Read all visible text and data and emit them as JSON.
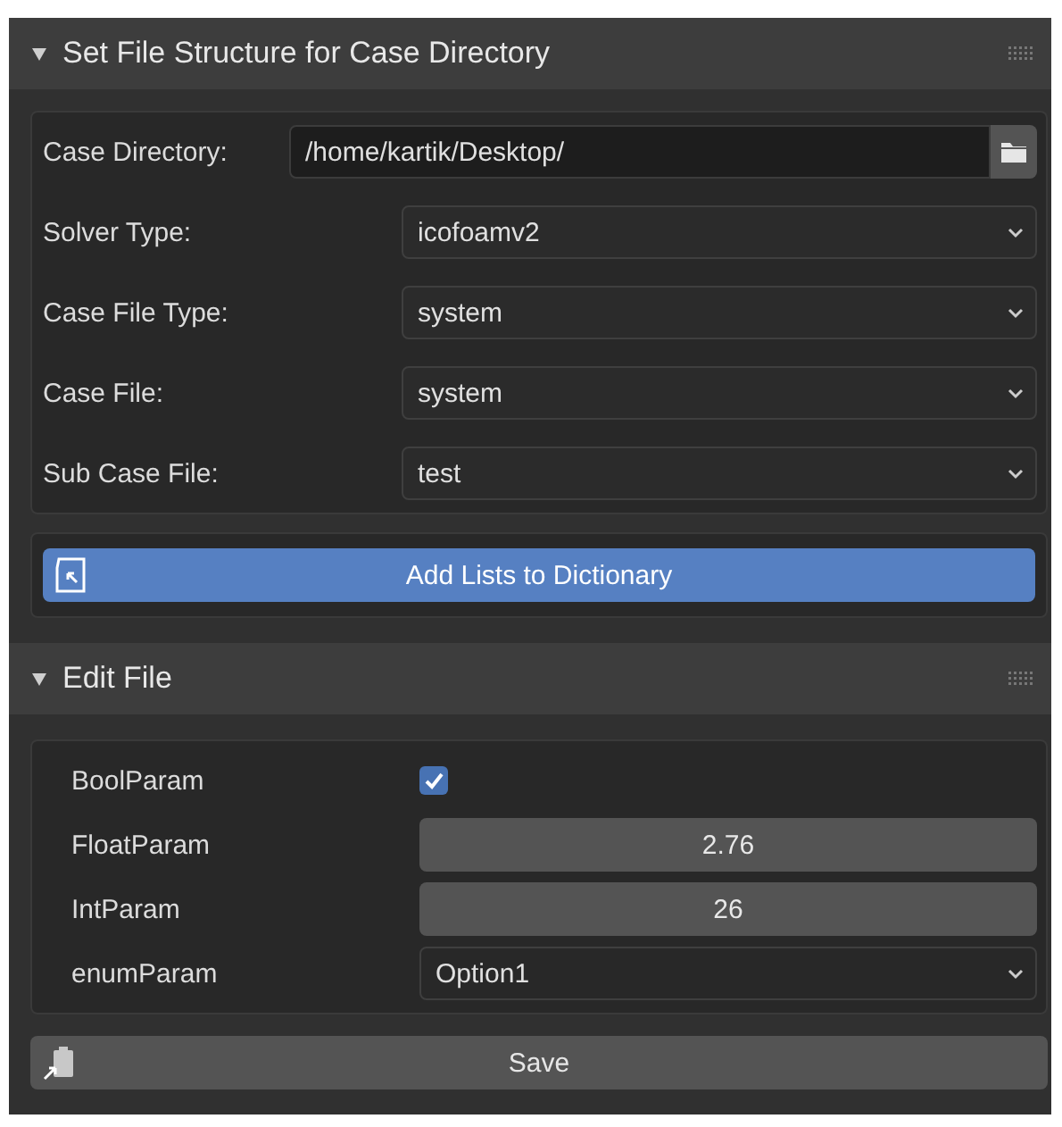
{
  "sections": [
    {
      "title": "Set File Structure for Case Directory",
      "expanded": true,
      "fields": [
        {
          "kind": "path",
          "label": "Case Directory:",
          "value": "/home/kartik/Desktop/"
        },
        {
          "kind": "dropdown",
          "label": "Solver Type:",
          "value": "icofoamv2"
        },
        {
          "kind": "dropdown",
          "label": "Case File Type:",
          "value": "system"
        },
        {
          "kind": "dropdown",
          "label": "Case File:",
          "value": "system"
        },
        {
          "kind": "dropdown",
          "label": "Sub Case File:",
          "value": "test"
        }
      ],
      "action": {
        "label": "Add Lists to Dictionary",
        "primary": true
      }
    },
    {
      "title": "Edit File",
      "expanded": true,
      "fields": [
        {
          "kind": "checkbox",
          "label": "BoolParam",
          "checked": true
        },
        {
          "kind": "number",
          "label": "FloatParam",
          "value": "2.76"
        },
        {
          "kind": "number",
          "label": "IntParam",
          "value": "26"
        },
        {
          "kind": "dropdown",
          "label": "enumParam",
          "value": "Option1"
        }
      ],
      "action": {
        "label": "Save",
        "primary": false
      }
    }
  ]
}
